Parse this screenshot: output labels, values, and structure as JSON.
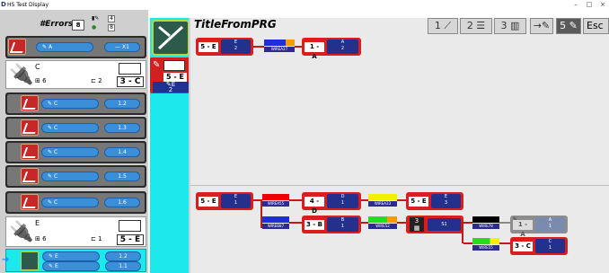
{
  "window": {
    "title": "HS Test Display",
    "app_icon": "D",
    "controls": [
      "–",
      "□",
      "×"
    ]
  },
  "errors": {
    "label": "#Errors:",
    "count": "8",
    "mini_a": "4",
    "mini_b": "8"
  },
  "left_rows": [
    {
      "type": "item",
      "pill": "A",
      "value": "X1"
    },
    {
      "type": "connector",
      "name": "C",
      "count": "6",
      "pins": "2",
      "tag": "3 - C"
    },
    {
      "type": "item",
      "pill": "C",
      "value": "1.2"
    },
    {
      "type": "item",
      "pill": "C",
      "value": "1.3"
    },
    {
      "type": "item",
      "pill": "C",
      "value": "1.4"
    },
    {
      "type": "item",
      "pill": "C",
      "value": "1.5"
    },
    {
      "type": "item",
      "pill": "C",
      "value": "1.6"
    },
    {
      "type": "connector",
      "name": "E",
      "count": "6",
      "pins": "1",
      "tag": "5 - E"
    },
    {
      "type": "selected",
      "pill1": "E",
      "pill2": "E",
      "v1": "1.2",
      "v2": "1.1"
    }
  ],
  "middle": {
    "card_tag": "5 - E",
    "card_sub1": "E",
    "card_sub2": "2"
  },
  "canvas": {
    "title": "TitleFromPRG",
    "toolbar": {
      "b1": "1",
      "b2": "2",
      "b3": "3",
      "b5": "5",
      "esc": "Esc"
    },
    "top_chain": {
      "n1": {
        "id": "5 - E",
        "top": "E",
        "bot": "2"
      },
      "wire": "WIREA27",
      "n2": {
        "id": "1 - A",
        "top": "A",
        "bot": "2"
      }
    },
    "bottom": {
      "src": {
        "id": "5 - E",
        "top": "E",
        "bot": "1"
      },
      "w1": "WIREA55",
      "n_d": {
        "id": "4 - D",
        "top": "D",
        "bot": "1"
      },
      "w2": "WIREA33",
      "n_e": {
        "id": "5 - E",
        "top": "E",
        "bot": "3"
      },
      "w3": "WIREB87",
      "n_b": {
        "id": "3 - B",
        "top": "B",
        "bot": "1"
      },
      "w4": "WIRE52",
      "splice": {
        "id": "3",
        "top": "S1"
      },
      "w5": "WIRE78",
      "n_a": {
        "id": "1 - A",
        "top": "A",
        "bot": "1"
      },
      "w6": "WIRE55",
      "n_c": {
        "id": "3 - C",
        "top": "C",
        "bot": "1"
      }
    }
  }
}
